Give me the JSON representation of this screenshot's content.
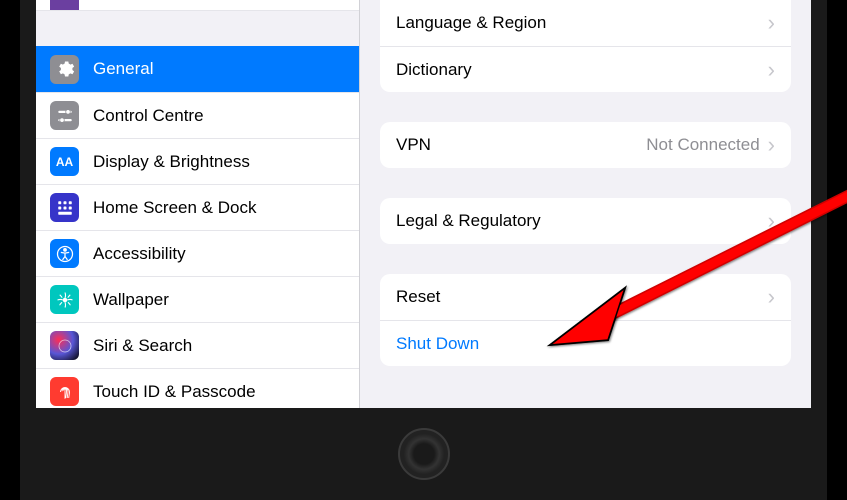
{
  "sidebar": {
    "items": [
      {
        "label": "General",
        "icon": "gear",
        "bg": "#8e8e93",
        "active": true
      },
      {
        "label": "Control Centre",
        "icon": "sliders",
        "bg": "#8e8e93"
      },
      {
        "label": "Display & Brightness",
        "icon": "aa",
        "bg": "#007aff"
      },
      {
        "label": "Home Screen & Dock",
        "icon": "grid",
        "bg": "#3a3ac2"
      },
      {
        "label": "Accessibility",
        "icon": "person",
        "bg": "#007aff"
      },
      {
        "label": "Wallpaper",
        "icon": "flower",
        "bg": "#00c7be"
      },
      {
        "label": "Siri & Search",
        "icon": "siri",
        "bg": "#000"
      },
      {
        "label": "Touch ID & Passcode",
        "icon": "fingerprint",
        "bg": "#ff3b30"
      }
    ]
  },
  "content": {
    "group1": [
      {
        "label": "Language & Region"
      },
      {
        "label": "Dictionary"
      }
    ],
    "group2": [
      {
        "label": "VPN",
        "value": "Not Connected"
      }
    ],
    "group3": [
      {
        "label": "Legal & Regulatory"
      }
    ],
    "group4": [
      {
        "label": "Reset"
      },
      {
        "label": "Shut Down",
        "link": true,
        "no_chevron": true
      }
    ]
  }
}
